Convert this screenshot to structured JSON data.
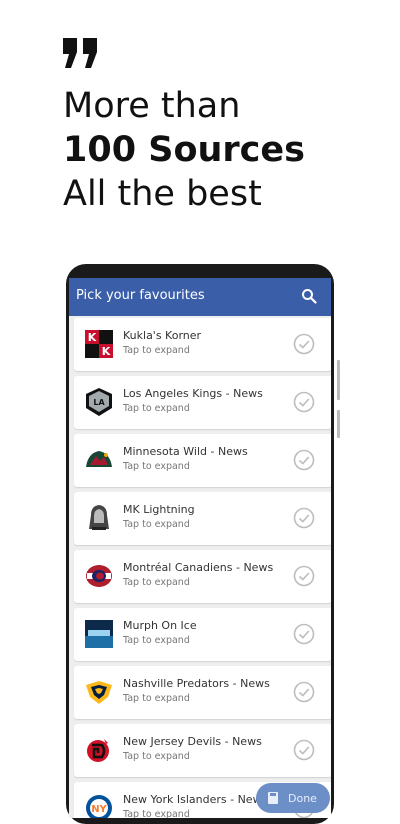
{
  "headline": {
    "line1": "More than",
    "line2": "100 Sources",
    "line3": "All the best"
  },
  "app": {
    "title": "Pick your favourites",
    "search_icon": "search-icon",
    "done_label": "Done",
    "accent": "#3a5ea8"
  },
  "sources": [
    {
      "name": "Kukla's Korner",
      "subtitle": "Tap to expand"
    },
    {
      "name": "Los Angeles Kings - News",
      "subtitle": "Tap to expand"
    },
    {
      "name": "Minnesota Wild - News",
      "subtitle": "Tap to expand"
    },
    {
      "name": "MK Lightning",
      "subtitle": "Tap to expand"
    },
    {
      "name": "Montréal Canadiens - News",
      "subtitle": "Tap to expand"
    },
    {
      "name": "Murph On Ice",
      "subtitle": "Tap to expand"
    },
    {
      "name": "Nashville Predators - News",
      "subtitle": "Tap to expand"
    },
    {
      "name": "New Jersey Devils - News",
      "subtitle": "Tap to expand"
    },
    {
      "name": "New York Islanders - News",
      "subtitle": "Tap to expand"
    }
  ]
}
